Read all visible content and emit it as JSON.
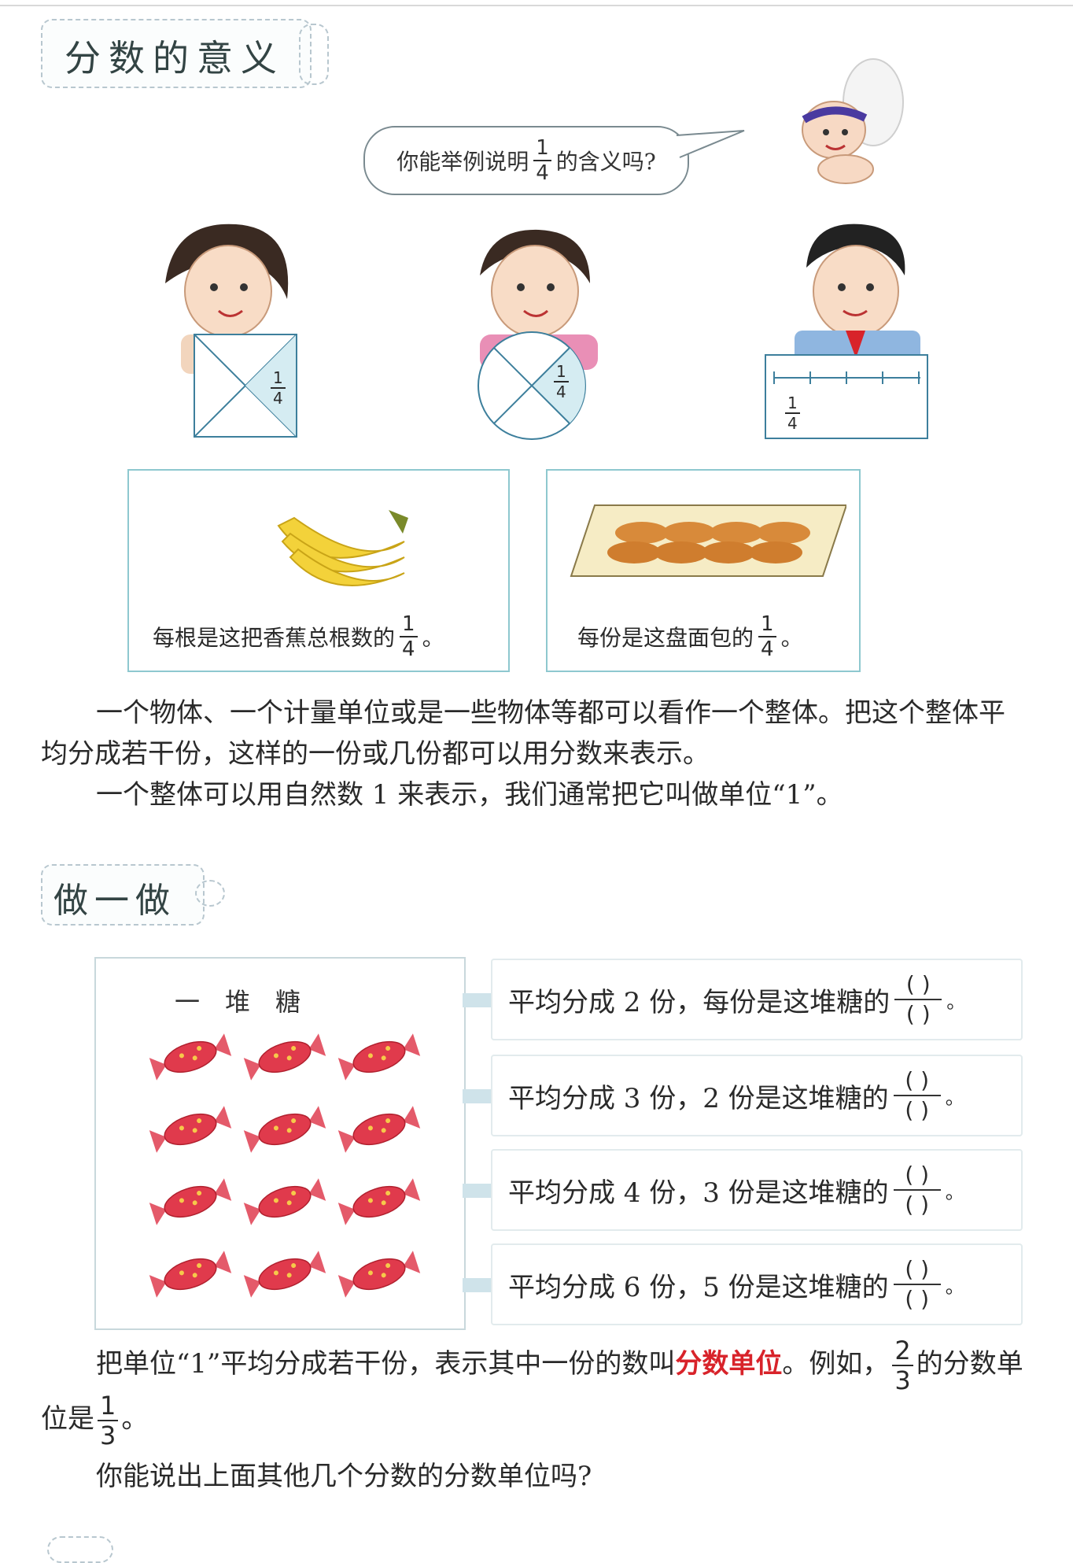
{
  "section_title": "分数的意义",
  "speech": {
    "before": "你能举例说明",
    "num": "1",
    "den": "4",
    "after": "的含义吗?"
  },
  "shape_fraction": {
    "num": "1",
    "den": "4"
  },
  "banana_caption": {
    "text": "每根是这把香蕉总根数的",
    "num": "1",
    "den": "4",
    "end": "。"
  },
  "bread_caption": {
    "text": "每份是这盘面包的",
    "num": "1",
    "den": "4",
    "end": "。"
  },
  "paragraph1": "一个物体、一个计量单位或是一些物体等都可以看作一个整体。把这个整体平均分成若干份，这样的一份或几份都可以用分数来表示。",
  "paragraph2": "一个整体可以用自然数 1 来表示，我们通常把它叫做单位“1”。",
  "practice_title": "做一做",
  "candy_title": "一　堆　糖",
  "exercises": [
    {
      "text": "平均分成 2 份，每份是这堆糖的"
    },
    {
      "text": "平均分成 3 份，2 份是这堆糖的"
    },
    {
      "text": "平均分成 4 份，3 份是这堆糖的"
    },
    {
      "text": "平均分成 6 份，5 份是这堆糖的"
    }
  ],
  "blank_paren": "(  )",
  "period": "。",
  "unit_para": {
    "part1": "把单位“1”平均分成若干份，表示其中一份的数叫",
    "highlight": "分数单位",
    "part2": "。例如，",
    "ex_num": "2",
    "ex_den": "3",
    "part3": "的分数单位是",
    "unit_num": "1",
    "unit_den": "3",
    "part4": "。",
    "highlight_color": "#d8232a"
  },
  "question": "你能说出上面其他几个分数的分数单位吗?"
}
